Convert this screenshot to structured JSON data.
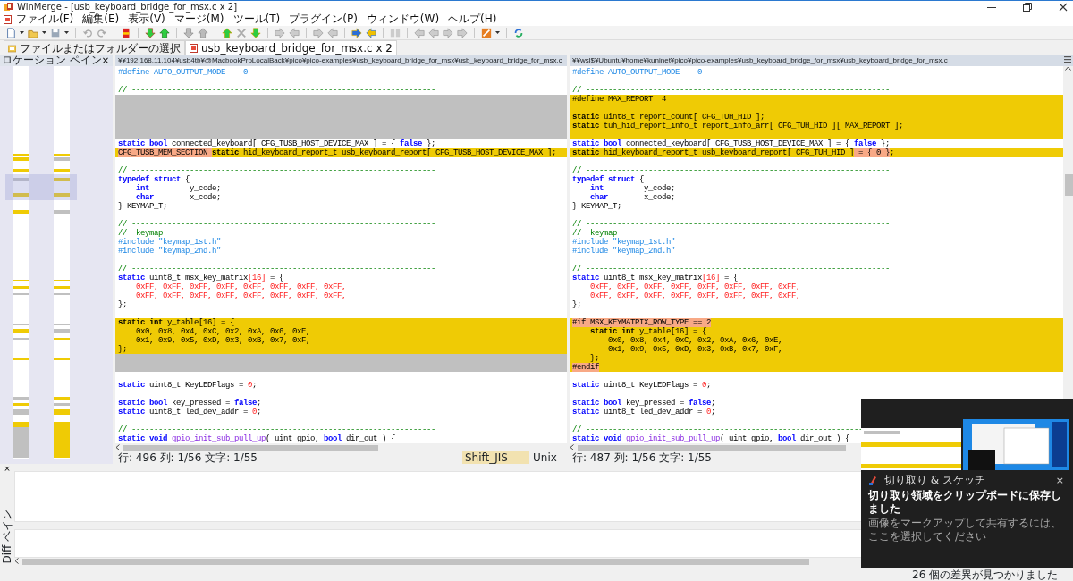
{
  "window": {
    "title": "WinMerge - [usb_keyboard_bridge_for_msx.c x 2]"
  },
  "menu": [
    "ファイル(F)",
    "編集(E)",
    "表示(V)",
    "マージ(M)",
    "ツール(T)",
    "プラグイン(P)",
    "ウィンドウ(W)",
    "ヘルプ(H)"
  ],
  "tabs": [
    {
      "label": "ファイルまたはフォルダーの選択",
      "selected": false
    },
    {
      "label": "usb_keyboard_bridge_for_msx.c x 2",
      "selected": true
    }
  ],
  "location_pane": {
    "title": "ロケーション ペイン",
    "close": "×"
  },
  "panes": [
    {
      "path": "¥¥192.168.11.104¥usb4tb¥@MacbookProLocalBack¥pico¥pico-examples¥usb_keyboard_bridge_for_msx¥usb_keyboard_bridge_for_msx.c",
      "lines": [
        {
          "kind": "same",
          "tokens": [
            {
              "kind": "preproc",
              "text": "#define AUTO_OUTPUT_MODE    0"
            }
          ]
        },
        {
          "kind": "same"
        },
        {
          "kind": "same",
          "tokens": [
            {
              "kind": "comment",
              "text": "// --------------------------------------------------------------------"
            }
          ]
        },
        {
          "kind": "missing"
        },
        {
          "kind": "missing"
        },
        {
          "kind": "missing"
        },
        {
          "kind": "missing"
        },
        {
          "kind": "missing"
        },
        {
          "kind": "same",
          "tokens": [
            {
              "kind": "keyword",
              "text": "static bool"
            },
            {
              "kind": "plain",
              "text": " connected_keyboard[ CFG_TUSB_HOST_DEVICE_MAX ] = { "
            },
            {
              "kind": "keyword",
              "text": "false"
            },
            {
              "kind": "plain",
              "text": " };"
            }
          ]
        },
        {
          "kind": "changed",
          "tokens": [
            {
              "kind": "highlight",
              "text": "CFG_TUSB_MEM_SECTION "
            },
            {
              "kind": "keyword",
              "text": "static"
            },
            {
              "kind": "plain",
              "text": " hid_keyboard_report_t usb_keyboard_report[ CFG_TUSB_HOST_DEVICE_MAX ];"
            }
          ]
        },
        {
          "kind": "same"
        },
        {
          "kind": "same",
          "tokens": [
            {
              "kind": "comment",
              "text": "// --------------------------------------------------------------------"
            }
          ]
        },
        {
          "kind": "same",
          "tokens": [
            {
              "kind": "keyword",
              "text": "typedef struct"
            },
            {
              "kind": "plain",
              "text": " {"
            }
          ]
        },
        {
          "kind": "same",
          "tokens": [
            {
              "kind": "keyword",
              "text": "    int"
            },
            {
              "kind": "plain",
              "text": "         y_code;"
            }
          ]
        },
        {
          "kind": "same",
          "tokens": [
            {
              "kind": "keyword",
              "text": "    char"
            },
            {
              "kind": "plain",
              "text": "        x_code;"
            }
          ]
        },
        {
          "kind": "same",
          "tokens": [
            {
              "kind": "plain",
              "text": "} KEYMAP_T;"
            }
          ]
        },
        {
          "kind": "same"
        },
        {
          "kind": "same",
          "tokens": [
            {
              "kind": "comment",
              "text": "// --------------------------------------------------------------------"
            }
          ]
        },
        {
          "kind": "same",
          "tokens": [
            {
              "kind": "comment",
              "text": "//  keymap"
            }
          ]
        },
        {
          "kind": "same",
          "tokens": [
            {
              "kind": "preproc",
              "text": "#include \"keymap_1st.h\""
            }
          ]
        },
        {
          "kind": "same",
          "tokens": [
            {
              "kind": "preproc",
              "text": "#include \"keymap_2nd.h\""
            }
          ]
        },
        {
          "kind": "same"
        },
        {
          "kind": "same",
          "tokens": [
            {
              "kind": "comment",
              "text": "// --------------------------------------------------------------------"
            }
          ]
        },
        {
          "kind": "same",
          "tokens": [
            {
              "kind": "keyword",
              "text": "static"
            },
            {
              "kind": "plain",
              "text": " uint8_t msx_key_matrix"
            },
            {
              "kind": "number",
              "text": "[16]"
            },
            {
              "kind": "plain",
              "text": " = {"
            }
          ]
        },
        {
          "kind": "same",
          "tokens": [
            {
              "kind": "number",
              "text": "    0xFF, 0xFF, 0xFF, 0xFF, 0xFF, 0xFF, 0xFF, 0xFF,"
            }
          ]
        },
        {
          "kind": "same",
          "tokens": [
            {
              "kind": "number",
              "text": "    0xFF, 0xFF, 0xFF, 0xFF, 0xFF, 0xFF, 0xFF, 0xFF,"
            }
          ]
        },
        {
          "kind": "same",
          "tokens": [
            {
              "kind": "plain",
              "text": "};"
            }
          ]
        },
        {
          "kind": "same"
        },
        {
          "kind": "changed",
          "tokens": [
            {
              "kind": "keyword",
              "text": "static int"
            },
            {
              "kind": "plain",
              "text": " y_table[16] = {"
            }
          ]
        },
        {
          "kind": "changed",
          "tokens": [
            {
              "kind": "plain",
              "text": "    0x0, 0x8, 0x4, 0xC, 0x2, 0xA, 0x6, 0xE,"
            }
          ]
        },
        {
          "kind": "changed",
          "tokens": [
            {
              "kind": "plain",
              "text": "    0x1, 0x9, 0x5, 0xD, 0x3, 0xB, 0x7, 0xF,"
            }
          ]
        },
        {
          "kind": "changed",
          "tokens": [
            {
              "kind": "plain",
              "text": "};"
            }
          ]
        },
        {
          "kind": "missing"
        },
        {
          "kind": "missing"
        },
        {
          "kind": "same"
        },
        {
          "kind": "same",
          "tokens": [
            {
              "kind": "keyword",
              "text": "static"
            },
            {
              "kind": "plain",
              "text": " uint8_t KeyLEDFlags = "
            },
            {
              "kind": "number",
              "text": "0"
            },
            {
              "kind": "plain",
              "text": ";"
            }
          ]
        },
        {
          "kind": "same"
        },
        {
          "kind": "same",
          "tokens": [
            {
              "kind": "keyword",
              "text": "static bool"
            },
            {
              "kind": "plain",
              "text": " key_pressed = "
            },
            {
              "kind": "keyword",
              "text": "false"
            },
            {
              "kind": "plain",
              "text": ";"
            }
          ]
        },
        {
          "kind": "same",
          "tokens": [
            {
              "kind": "keyword",
              "text": "static"
            },
            {
              "kind": "plain",
              "text": " uint8_t led_dev_addr = "
            },
            {
              "kind": "number",
              "text": "0"
            },
            {
              "kind": "plain",
              "text": ";"
            }
          ]
        },
        {
          "kind": "same"
        },
        {
          "kind": "same",
          "tokens": [
            {
              "kind": "comment",
              "text": "// --------------------------------------------------------------------"
            }
          ]
        },
        {
          "kind": "same",
          "tokens": [
            {
              "kind": "keyword",
              "text": "static void"
            },
            {
              "kind": "function",
              "text": " gpio_init_sub_pull_up"
            },
            {
              "kind": "plain",
              "text": "( uint gpio, "
            },
            {
              "kind": "keyword",
              "text": "bool"
            },
            {
              "kind": "plain",
              "text": " dir_out ) {"
            }
          ]
        }
      ],
      "status": {
        "position": "行: 496 列: 1/56 文字: 1/55",
        "encoding": "Shift_JIS",
        "eol": "Unix"
      }
    },
    {
      "path": "¥¥wsl$¥Ubuntu¥home¥kuninet¥pico¥pico-examples¥usb_keyboard_bridge_for_msx¥usb_keyboard_bridge_for_msx.c",
      "lines": [
        {
          "kind": "same",
          "tokens": [
            {
              "kind": "preproc",
              "text": "#define AUTO_OUTPUT_MODE    0"
            }
          ]
        },
        {
          "kind": "same"
        },
        {
          "kind": "same",
          "tokens": [
            {
              "kind": "comment",
              "text": "// --------------------------------------------------------------------"
            }
          ]
        },
        {
          "kind": "changed",
          "tokens": [
            {
              "kind": "plain",
              "text": "#define MAX_REPORT  4"
            }
          ]
        },
        {
          "kind": "changed"
        },
        {
          "kind": "changed",
          "tokens": [
            {
              "kind": "keyword",
              "text": "static"
            },
            {
              "kind": "plain",
              "text": " uint8_t report_count[ CFG_TUH_HID ];"
            }
          ]
        },
        {
          "kind": "changed",
          "tokens": [
            {
              "kind": "keyword",
              "text": "static"
            },
            {
              "kind": "plain",
              "text": " tuh_hid_report_info_t report_info_arr[ CFG_TUH_HID ][ MAX_REPORT ];"
            }
          ]
        },
        {
          "kind": "changed"
        },
        {
          "kind": "same",
          "tokens": [
            {
              "kind": "keyword",
              "text": "static bool"
            },
            {
              "kind": "plain",
              "text": " connected_keyboard[ CFG_TUSB_HOST_DEVICE_MAX ] = { "
            },
            {
              "kind": "keyword",
              "text": "false"
            },
            {
              "kind": "plain",
              "text": " };"
            }
          ]
        },
        {
          "kind": "changed",
          "tokens": [
            {
              "kind": "keyword",
              "text": "static"
            },
            {
              "kind": "plain",
              "text": " hid_keyboard_report_t usb_keyboard_report[ CFG_TUH_HID ]"
            },
            {
              "kind": "highlight",
              "text": " = { 0 }"
            },
            {
              "kind": "plain",
              "text": ";"
            }
          ]
        },
        {
          "kind": "same"
        },
        {
          "kind": "same",
          "tokens": [
            {
              "kind": "comment",
              "text": "// --------------------------------------------------------------------"
            }
          ]
        },
        {
          "kind": "same",
          "tokens": [
            {
              "kind": "keyword",
              "text": "typedef struct"
            },
            {
              "kind": "plain",
              "text": " {"
            }
          ]
        },
        {
          "kind": "same",
          "tokens": [
            {
              "kind": "keyword",
              "text": "    int"
            },
            {
              "kind": "plain",
              "text": "         y_code;"
            }
          ]
        },
        {
          "kind": "same",
          "tokens": [
            {
              "kind": "keyword",
              "text": "    char"
            },
            {
              "kind": "plain",
              "text": "        x_code;"
            }
          ]
        },
        {
          "kind": "same",
          "tokens": [
            {
              "kind": "plain",
              "text": "} KEYMAP_T;"
            }
          ]
        },
        {
          "kind": "same"
        },
        {
          "kind": "same",
          "tokens": [
            {
              "kind": "comment",
              "text": "// --------------------------------------------------------------------"
            }
          ]
        },
        {
          "kind": "same",
          "tokens": [
            {
              "kind": "comment",
              "text": "//  keymap"
            }
          ]
        },
        {
          "kind": "same",
          "tokens": [
            {
              "kind": "preproc",
              "text": "#include \"keymap_1st.h\""
            }
          ]
        },
        {
          "kind": "same",
          "tokens": [
            {
              "kind": "preproc",
              "text": "#include \"keymap_2nd.h\""
            }
          ]
        },
        {
          "kind": "same"
        },
        {
          "kind": "same",
          "tokens": [
            {
              "kind": "comment",
              "text": "// --------------------------------------------------------------------"
            }
          ]
        },
        {
          "kind": "same",
          "tokens": [
            {
              "kind": "keyword",
              "text": "static"
            },
            {
              "kind": "plain",
              "text": " uint8_t msx_key_matrix"
            },
            {
              "kind": "number",
              "text": "[16]"
            },
            {
              "kind": "plain",
              "text": " = {"
            }
          ]
        },
        {
          "kind": "same",
          "tokens": [
            {
              "kind": "number",
              "text": "    0xFF, 0xFF, 0xFF, 0xFF, 0xFF, 0xFF, 0xFF, 0xFF,"
            }
          ]
        },
        {
          "kind": "same",
          "tokens": [
            {
              "kind": "number",
              "text": "    0xFF, 0xFF, 0xFF, 0xFF, 0xFF, 0xFF, 0xFF, 0xFF,"
            }
          ]
        },
        {
          "kind": "same",
          "tokens": [
            {
              "kind": "plain",
              "text": "};"
            }
          ]
        },
        {
          "kind": "same"
        },
        {
          "kind": "changed",
          "tokens": [
            {
              "kind": "highlight",
              "text": "#if MSX_KEYMATRIX_ROW_TYPE == 2"
            }
          ]
        },
        {
          "kind": "changed",
          "tokens": [
            {
              "kind": "keyword",
              "text": "    static int"
            },
            {
              "kind": "plain",
              "text": " y_table[16] = {"
            }
          ]
        },
        {
          "kind": "changed",
          "tokens": [
            {
              "kind": "plain",
              "text": "        0x0, 0x8, 0x4, 0xC, 0x2, 0xA, 0x6, 0xE,"
            }
          ]
        },
        {
          "kind": "changed",
          "tokens": [
            {
              "kind": "plain",
              "text": "        0x1, 0x9, 0x5, 0xD, 0x3, 0xB, 0x7, 0xF,"
            }
          ]
        },
        {
          "kind": "changed",
          "tokens": [
            {
              "kind": "plain",
              "text": "    };"
            }
          ]
        },
        {
          "kind": "changed",
          "tokens": [
            {
              "kind": "highlight",
              "text": "#endif"
            }
          ]
        },
        {
          "kind": "same"
        },
        {
          "kind": "same",
          "tokens": [
            {
              "kind": "keyword",
              "text": "static"
            },
            {
              "kind": "plain",
              "text": " uint8_t KeyLEDFlags = "
            },
            {
              "kind": "number",
              "text": "0"
            },
            {
              "kind": "plain",
              "text": ";"
            }
          ]
        },
        {
          "kind": "same"
        },
        {
          "kind": "same",
          "tokens": [
            {
              "kind": "keyword",
              "text": "static bool"
            },
            {
              "kind": "plain",
              "text": " key_pressed = "
            },
            {
              "kind": "keyword",
              "text": "false"
            },
            {
              "kind": "plain",
              "text": ";"
            }
          ]
        },
        {
          "kind": "same",
          "tokens": [
            {
              "kind": "keyword",
              "text": "static"
            },
            {
              "kind": "plain",
              "text": " uint8_t led_dev_addr = "
            },
            {
              "kind": "number",
              "text": "0"
            },
            {
              "kind": "plain",
              "text": ";"
            }
          ]
        },
        {
          "kind": "same"
        },
        {
          "kind": "same",
          "tokens": [
            {
              "kind": "comment",
              "text": "// --------------------------------------------------------------"
            }
          ]
        },
        {
          "kind": "same",
          "tokens": [
            {
              "kind": "keyword",
              "text": "static void"
            },
            {
              "kind": "function",
              "text": " gpio_init_sub_pull_up"
            },
            {
              "kind": "plain",
              "text": "( uint gpio, "
            },
            {
              "kind": "keyword",
              "text": "bool"
            },
            {
              "kind": "plain",
              "text": " dir_out ) {"
            }
          ]
        }
      ],
      "status": {
        "position": "行: 487 列: 1/56 文字: 1/55"
      }
    }
  ],
  "diff_pane": {
    "title": "Diff ペイン",
    "close": "×"
  },
  "notification": {
    "app": "切り取り & スケッチ",
    "close": "×",
    "title": "切り取り領域をクリップボードに保存しました",
    "body": "画像をマークアップして共有するには、ここを選択してください"
  },
  "status_bar": {
    "message": "26 個の差異が見つかりました"
  }
}
